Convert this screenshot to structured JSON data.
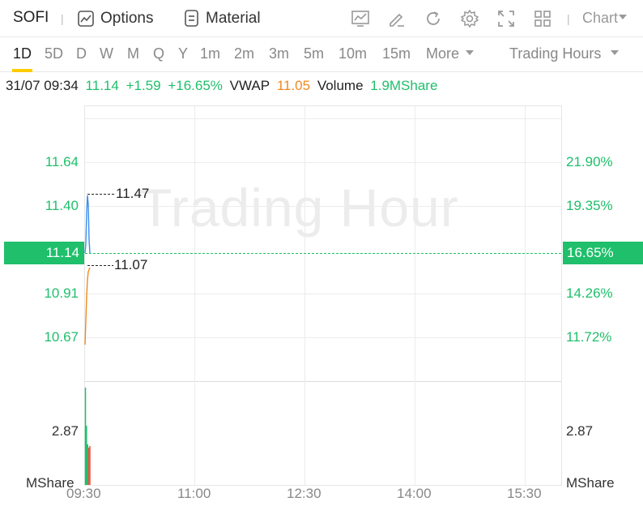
{
  "toolbar": {
    "ticker": "SOFI",
    "options_label": "Options",
    "material_label": "Material",
    "chart_label": "Chart",
    "icons": [
      "trend-chart-icon",
      "pen-icon",
      "refresh-icon",
      "gear-icon",
      "fullscreen-icon",
      "grid-layout-icon"
    ]
  },
  "periods": {
    "items": [
      "1D",
      "5D",
      "D",
      "W",
      "M",
      "Q",
      "Y",
      "1m",
      "2m",
      "3m",
      "5m",
      "10m",
      "15m"
    ],
    "active": "1D",
    "more_label": "More",
    "session_label": "Trading Hours"
  },
  "info": {
    "datetime": "31/07 09:34",
    "price": "11.14",
    "change": "+1.59",
    "change_pct": "+16.65%",
    "vwap_label": "VWAP",
    "vwap": "11.05",
    "volume_label": "Volume",
    "volume": "1.9MShare"
  },
  "chart": {
    "watermark": "Trading Hour",
    "price_axis": [
      "11.64",
      "11.40",
      "10.91",
      "10.67"
    ],
    "pct_axis": [
      "21.90%",
      "19.35%",
      "14.26%",
      "11.72%"
    ],
    "current_price": "11.14",
    "current_pct": "16.65%",
    "high_label": "11.47",
    "low_label": "11.07",
    "volume_axis_value": "2.87",
    "volume_unit": "MShare",
    "time_axis": [
      "09:30",
      "11:00",
      "12:30",
      "14:00",
      "15:30"
    ],
    "colors": {
      "up": "#1fbf6b",
      "down": "#e8533f",
      "price_line": "#3b8ee8",
      "vwap_line": "#f08a1e"
    }
  }
}
